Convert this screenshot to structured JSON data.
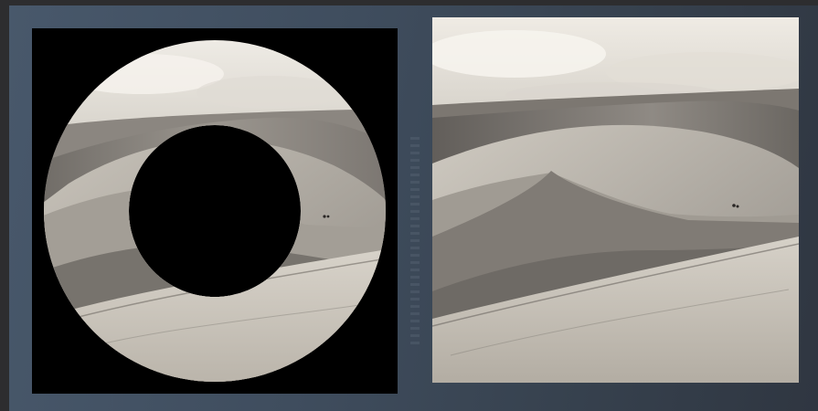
{
  "scene": {
    "subject": "sand-dunes",
    "tone": "sepia-monochrome",
    "colors": {
      "background": "#2d2d2f",
      "stage": "#44526a",
      "mask": "#000000",
      "sky": "#e7e3dc",
      "dune_light": "#d5d0c7",
      "dune_mid": "#9a958e",
      "dune_shadow": "#5c5854"
    }
  },
  "panels": [
    {
      "id": "annulus-masked-view",
      "mask": "ring"
    },
    {
      "id": "original-view",
      "mask": "none"
    }
  ]
}
